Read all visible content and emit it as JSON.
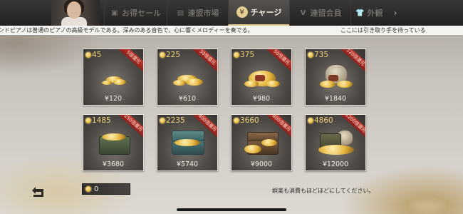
{
  "tabs": [
    {
      "label": "お得セール",
      "icon": "shopping-bag-icon",
      "active": false,
      "width": 88
    },
    {
      "label": "連盟市場",
      "icon": "market-icon",
      "active": false,
      "width": 86
    },
    {
      "label": "チャージ",
      "icon": "charge-coin-icon",
      "active": true,
      "width": 86
    },
    {
      "label": "連盟会員",
      "icon": "membership-v-icon",
      "active": false,
      "width": 86
    },
    {
      "label": "外観",
      "icon": "tshirt-icon",
      "active": false,
      "width": 52
    }
  ],
  "ticker": {
    "left": "ンドピアノは普通のピアノの高級モデルである。深みのある音色で、心に響くメロディーを奏でる。",
    "right": "ここには引き取り手を待っている"
  },
  "packages": [
    {
      "amount": "45",
      "price": "¥120",
      "badge": "5倍還元",
      "art": "small-coins"
    },
    {
      "amount": "225",
      "price": "¥610",
      "badge": "30倍還元",
      "art": "small-coins"
    },
    {
      "amount": "375",
      "price": "¥980",
      "badge": "50倍還元",
      "art": "coin-pile"
    },
    {
      "amount": "735",
      "price": "¥1840",
      "badge": "120倍還元",
      "art": "coin-sack"
    },
    {
      "amount": "1485",
      "price": "¥3680",
      "badge": "250倍還元",
      "art": "green-chest"
    },
    {
      "amount": "2235",
      "price": "¥5740",
      "badge": "400倍還元",
      "art": "teal-chest"
    },
    {
      "amount": "3660",
      "price": "¥9000",
      "badge": "800倍還元",
      "art": "wood-chest"
    },
    {
      "amount": "4860",
      "price": "¥12000",
      "badge": "1200倍還元",
      "art": "treasure-hoard"
    }
  ],
  "balance": {
    "value": "0"
  },
  "footer_note": "娯楽も消費もほどほどにしてください。",
  "colors": {
    "gold": "#f0d37a",
    "ribbon": "#b3302a",
    "active_tab_text": "#f2ede4"
  }
}
